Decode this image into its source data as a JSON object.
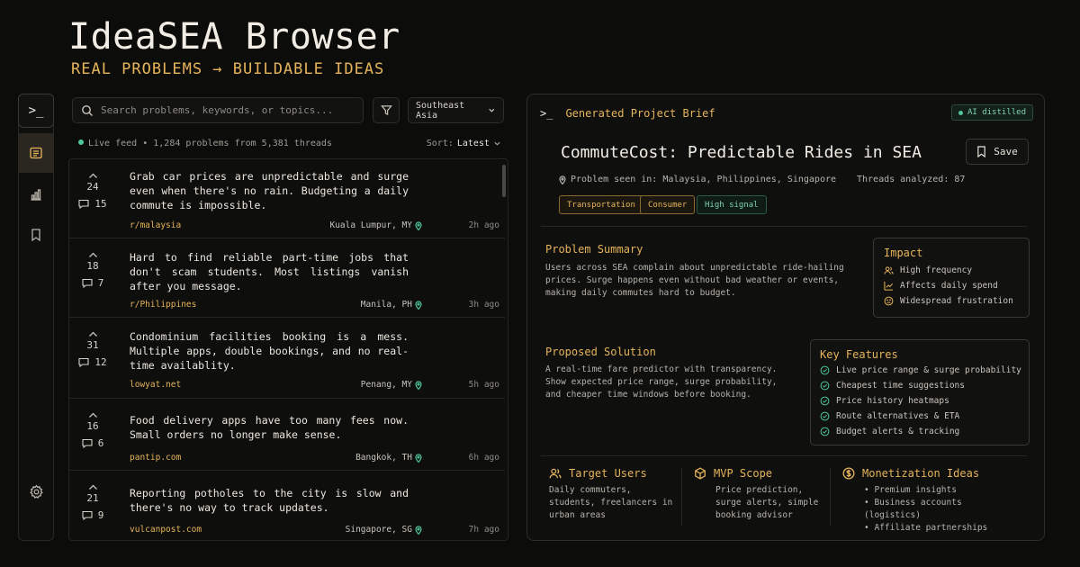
{
  "header": {
    "title": "IdeaSEA Browser",
    "tagline": "REAL PROBLEMS → BUILDABLE IDEAS"
  },
  "sidebar": {
    "terminal_icon": ">_",
    "items": [
      "feed-icon",
      "chart-icon",
      "bookmark-icon"
    ],
    "settings": "gear-icon"
  },
  "search": {
    "placeholder": "Search problems, keywords, or topics...",
    "region": "Southeast Asia"
  },
  "feed_status": {
    "label": "Live feed",
    "stats": "• 1,284 problems from 5,381 threads",
    "sort_label": "Sort:",
    "sort_value": "Latest"
  },
  "posts": [
    {
      "votes": "24",
      "comments": "15",
      "text": "Grab car prices are unpredictable and surge even when there's no rain. Budgeting a daily commute is impossible.",
      "source": "r/malaysia",
      "location": "Kuala Lumpur, MY",
      "time": "2h ago"
    },
    {
      "votes": "18",
      "comments": "7",
      "text": "Hard to find reliable part-time jobs that don't scam students. Most listings vanish after you message.",
      "source": "r/Philippines",
      "location": "Manila, PH",
      "time": "3h ago"
    },
    {
      "votes": "31",
      "comments": "12",
      "text": "Condominium facilities booking is a mess. Multiple apps, double bookings, and no real-time availablity.",
      "source": "lowyat.net",
      "location": "Penang, MY",
      "time": "5h ago"
    },
    {
      "votes": "16",
      "comments": "6",
      "text": "Food delivery apps have too many fees now. Small orders no longer make sense.",
      "source": "pantip.com",
      "location": "Bangkok, TH",
      "time": "6h ago"
    },
    {
      "votes": "21",
      "comments": "9",
      "text": "Reporting potholes to the city is slow and there's no way to track updates.",
      "source": "vulcanpost.com",
      "location": "Singapore, SG",
      "time": "7h ago"
    }
  ],
  "brief": {
    "prompt": ">_",
    "heading": "Generated Project Brief",
    "badge": "AI distilled",
    "title": "CommuteCost: Predictable Rides in SEA",
    "save": "Save",
    "seen_in": "Problem seen in: Malaysia, Philippines, Singapore",
    "threads": "Threads analyzed: 87",
    "tags": [
      "Transportation",
      "Consumer",
      "High signal"
    ],
    "problem_heading": "Problem Summary",
    "problem_text": "Users across SEA complain about unpredictable ride-hailing prices. Surge happens even without bad weather or events, making daily commutes hard to budget.",
    "impact_heading": "Impact",
    "impact": [
      "High frequency",
      "Affects daily spend",
      "Widespread frustration"
    ],
    "solution_heading": "Proposed Solution",
    "solution_text": "A real-time fare predictor with transparency. Show expected price range, surge probability, and cheaper time windows before booking.",
    "features_heading": "Key Features",
    "features": [
      "Live price range & surge probability",
      "Cheapest time suggestions",
      "Price history heatmaps",
      "Route alternatives & ETA",
      "Budget alerts & tracking"
    ],
    "users_heading": "Target Users",
    "users_text": "Daily commuters, students, freelancers in urban areas",
    "mvp_heading": "MVP Scope",
    "mvp_text": "Price prediction, surge alerts, simple booking advisor",
    "money_heading": "Monetization Ideas",
    "money": [
      "• Premium insights",
      "• Business accounts (logistics)",
      "• Affiliate partnerships"
    ]
  },
  "colors": {
    "accent": "#e6b45a",
    "live": "#4ec79b",
    "bg": "#0c0c0b"
  }
}
